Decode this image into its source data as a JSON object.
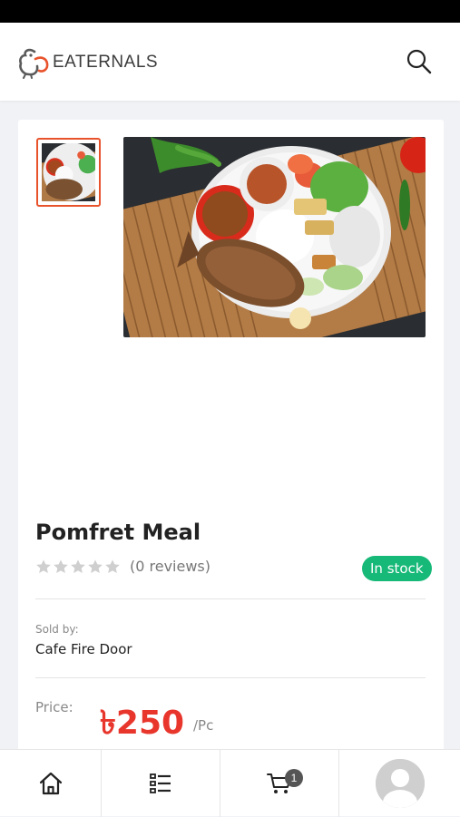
{
  "header": {
    "brand": "EATERNALS",
    "search_icon": "search-icon"
  },
  "product": {
    "title": "Pomfret Meal",
    "rating": 0,
    "rating_max": 5,
    "reviews_text": "(0 reviews)",
    "stock_status": "In stock",
    "sold_by_label": "Sold by:",
    "seller": "Cafe Fire Door",
    "price_label": "Price:",
    "price": "৳250",
    "unit": "/Pc"
  },
  "bottom_nav": {
    "items": [
      "home-icon",
      "category-list-icon",
      "cart-icon",
      "profile-avatar"
    ],
    "cart_count": "1"
  },
  "colors": {
    "accent": "#e8362c",
    "thumb_border": "#e8532c",
    "in_stock": "#17b978"
  }
}
